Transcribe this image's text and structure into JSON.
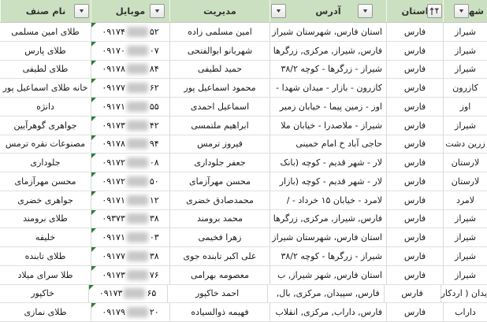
{
  "colors": {
    "header_bg": "#CBE0C0",
    "grid": "#D9D9D9",
    "text": "#1B1B1B",
    "error_triangle_green": "#2E7D32"
  },
  "table": {
    "columns": [
      {
        "key": "city",
        "label": "شهر",
        "filter": "dropdown"
      },
      {
        "key": "province",
        "label": "استان",
        "filter": "sorted-filter"
      },
      {
        "key": "address",
        "label": "آدرس",
        "filter": "dropdown"
      },
      {
        "key": "manager",
        "label": "مدیریت",
        "filter": "dropdown"
      },
      {
        "key": "mobile",
        "label": "موبایل",
        "filter": "dropdown"
      },
      {
        "key": "shop",
        "label": "نام صنف",
        "filter": "dropdown"
      }
    ],
    "rows": [
      {
        "city": "شیراز",
        "province": "فارس",
        "address": "استان فارس، شهرستان شیراز",
        "manager": "امین مسلمی زاده",
        "mobile_prefix": "۰۹۱۷۴",
        "mobile_suffix": "۵۲",
        "shop": "طلای امین مسلمی"
      },
      {
        "city": "شیراز",
        "province": "فارس",
        "address": "فارس, شیراز, مرکزی, زرگرها",
        "manager": "شهربانو ابوالفتحی",
        "mobile_prefix": "۰۹۱۷۰",
        "mobile_suffix": "۰۷",
        "shop": "طلای پارس"
      },
      {
        "city": "شیراز",
        "province": "فارس",
        "address": "شیراز - زرگرها - کوچه ۳۸/۲",
        "manager": "حمید لطیفی",
        "mobile_prefix": "۰۹۱۷۸",
        "mobile_suffix": "۸۴",
        "shop": "طلای لطیفی"
      },
      {
        "city": "کازرون",
        "province": "فارس",
        "address": "کازرون - بازار - میدان شهدا -",
        "manager": "محمود اسماعیل پور",
        "mobile_prefix": "۰۹۱۷۷",
        "mobile_suffix": "۶۲",
        "shop": "خانه طلای اسماعیل پور"
      },
      {
        "city": "اوز",
        "province": "فارس",
        "address": "اوز - زمین پیما - خیابان زمیر",
        "manager": "اسماعیل احمدی",
        "mobile_prefix": "۰۹۱۷۱",
        "mobile_suffix": "۵۵",
        "shop": "دانژه"
      },
      {
        "city": "شیراز",
        "province": "فارس",
        "address": "شیراز - ملاصدرا - خیابان ملا",
        "manager": "ابراهیم ملتمسی",
        "mobile_prefix": "۰۹۱۷۳",
        "mobile_suffix": "۴۲",
        "shop": "جواهری گوهرآیین"
      },
      {
        "city": "زرین دشت",
        "province": "فارس",
        "address": "حاجی آباد خ امام خمینی",
        "manager": "فیروز ترمس",
        "mobile_prefix": "۰۹۱۷۸",
        "mobile_suffix": "۹۴",
        "shop": "مصنوعات نقره ترمس"
      },
      {
        "city": "لارستان",
        "province": "فارس",
        "address": "لار - شهر قدیم - کوچه (بانک",
        "manager": "جعفر جلوداری",
        "mobile_prefix": "۰۹۱۷۲",
        "mobile_suffix": "۰۸",
        "shop": "جلوداری"
      },
      {
        "city": "لارستان",
        "province": "فارس",
        "address": "لار - شهر قدیم - کوچه (بازار",
        "manager": "محسن مهرآزمای",
        "mobile_prefix": "۰۹۱۷۲",
        "mobile_suffix": "۵۰",
        "shop": "محسن مهرآزمای"
      },
      {
        "city": "لامرد",
        "province": "فارس",
        "address": "لامرد - خیابان ۱۵ خرداد - /",
        "manager": "محمدصادق خضری",
        "mobile_prefix": "۰۹۱۷۱",
        "mobile_suffix": "۱۲",
        "shop": "جواهری خضری"
      },
      {
        "city": "شیراز",
        "province": "فارس",
        "address": "فارس, شیراز, مرکزی, زرگرها",
        "manager": "محمد برومند",
        "mobile_prefix": "۰۹۳۷۳",
        "mobile_suffix": "۳۸",
        "shop": "طلای برومند"
      },
      {
        "city": "شیراز",
        "province": "فارس",
        "address": "استان فارس، شهرستان شیراز",
        "manager": "زهرا فخیمی",
        "mobile_prefix": "۰۹۱۷۱",
        "mobile_suffix": "۰۳",
        "shop": "خلیفه"
      },
      {
        "city": "شیراز",
        "province": "فارس",
        "address": "شیراز - زرگرها - کوچه ۳۸/۲",
        "manager": "علی اکبر تابنده جوی",
        "mobile_prefix": "۰۹۱۷۷",
        "mobile_suffix": "۳۸",
        "shop": "طلای تابنده"
      },
      {
        "city": "شیراز",
        "province": "فارس",
        "address": "استان فارس,  شهر شیراز,  ب",
        "manager": "معصومه بهرامی",
        "mobile_prefix": "۰۹۱۷۳",
        "mobile_suffix": "۷۶",
        "shop": "طلا سرای میلاد"
      },
      {
        "city": "یدان ( اردکار",
        "province": "فارس",
        "address": "فارس, سپیدان, مرکزی, بال,",
        "manager": "احمد خاکپور",
        "mobile_prefix": "۰۹۱۷۳",
        "mobile_suffix": "۶۵",
        "shop": "خاکپور"
      },
      {
        "city": "داراب",
        "province": "فارس",
        "address": "فارس, داراب, مرکزی, انقلاب",
        "manager": "فهیمه ذوالسیاده",
        "mobile_prefix": "۰۹۱۷۹",
        "mobile_suffix": "۲۰",
        "shop": "طلای نمازی"
      }
    ]
  }
}
